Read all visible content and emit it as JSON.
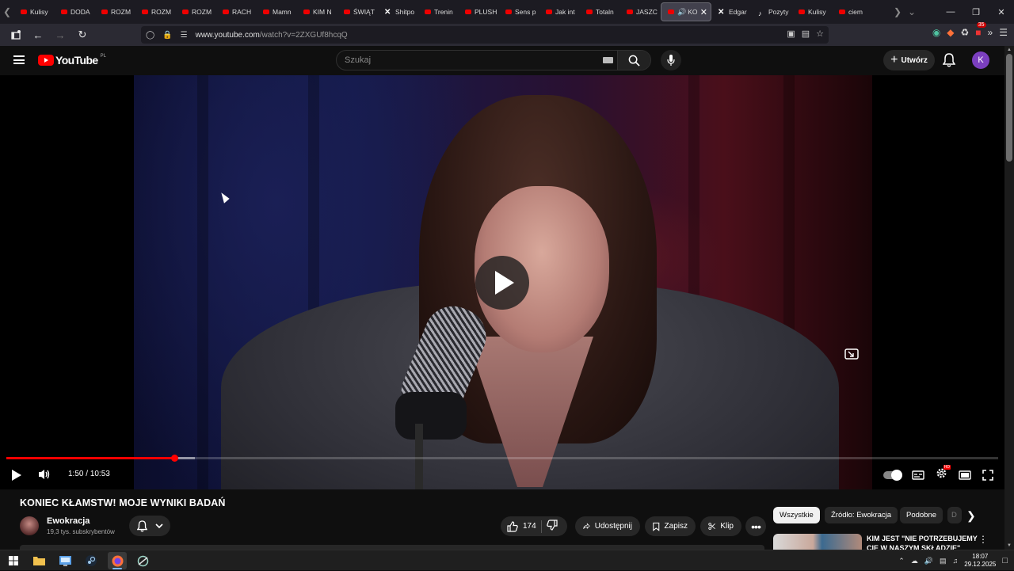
{
  "browser": {
    "tabs": [
      {
        "label": "Kulisy",
        "icon": "youtube-icon"
      },
      {
        "label": "DODA",
        "icon": "youtube-icon"
      },
      {
        "label": "ROZM",
        "icon": "youtube-icon"
      },
      {
        "label": "ROZM",
        "icon": "youtube-icon"
      },
      {
        "label": "ROZM",
        "icon": "youtube-icon"
      },
      {
        "label": "RACH",
        "icon": "youtube-icon"
      },
      {
        "label": "Mamn",
        "icon": "youtube-icon"
      },
      {
        "label": "KIM N",
        "icon": "youtube-icon"
      },
      {
        "label": "ŚWIĄT",
        "icon": "youtube-icon"
      },
      {
        "label": "Shitpo",
        "icon": "x-icon"
      },
      {
        "label": "Trenin",
        "icon": "youtube-icon"
      },
      {
        "label": "PLUSH",
        "icon": "youtube-icon"
      },
      {
        "label": "Sens p",
        "icon": "youtube-icon"
      },
      {
        "label": "Jak int",
        "icon": "youtube-icon"
      },
      {
        "label": "Totaln",
        "icon": "youtube-icon"
      },
      {
        "label": "JASZC",
        "icon": "youtube-icon"
      },
      {
        "label": "KO",
        "icon": "youtube-icon",
        "active": true
      },
      {
        "label": "Edgar",
        "icon": "x-icon"
      },
      {
        "label": "Pozyty",
        "icon": "tiktok-icon"
      },
      {
        "label": "Kulisy",
        "icon": "youtube-icon"
      },
      {
        "label": "ciem",
        "icon": "youtube-icon"
      }
    ],
    "url_host": "www.youtube.com",
    "url_path": "/watch?v=2ZXGUf8hcqQ",
    "extension_badge": "35"
  },
  "youtube": {
    "logo_text": "YouTube",
    "logo_region": "PL",
    "search_placeholder": "Szukaj",
    "create_label": "Utwórz",
    "avatar_letter": "K"
  },
  "player": {
    "time_current": "1:50",
    "time_separator": "/",
    "time_total": "10:53",
    "progress_played": 0.169,
    "progress_loaded": 0.19,
    "quality_badge": "HD"
  },
  "video": {
    "title": "KONIEC KŁAMSTW! MOJE WYNIKI BADAŃ",
    "channel_name": "Ewokracja",
    "subscribers": "19,3 tys. subskrybentów",
    "likes": "174",
    "share_label": "Udostępnij",
    "save_label": "Zapisz",
    "clip_label": "Klip"
  },
  "sidebar": {
    "chips": [
      "Wszystkie",
      "Źródło: Ewokracja",
      "Podobne",
      "D"
    ],
    "recommendation_title": "KIM JEST \"NIE POTRZEBUJEMY CIĘ W NASZYM SKŁADZIE\""
  },
  "taskbar": {
    "time": "18:07",
    "date": "29.12.2025"
  },
  "colors": {
    "youtube_red": "#ff0000",
    "avatar_purple": "#7b3fbf",
    "page_bg": "#0f0f0f"
  }
}
